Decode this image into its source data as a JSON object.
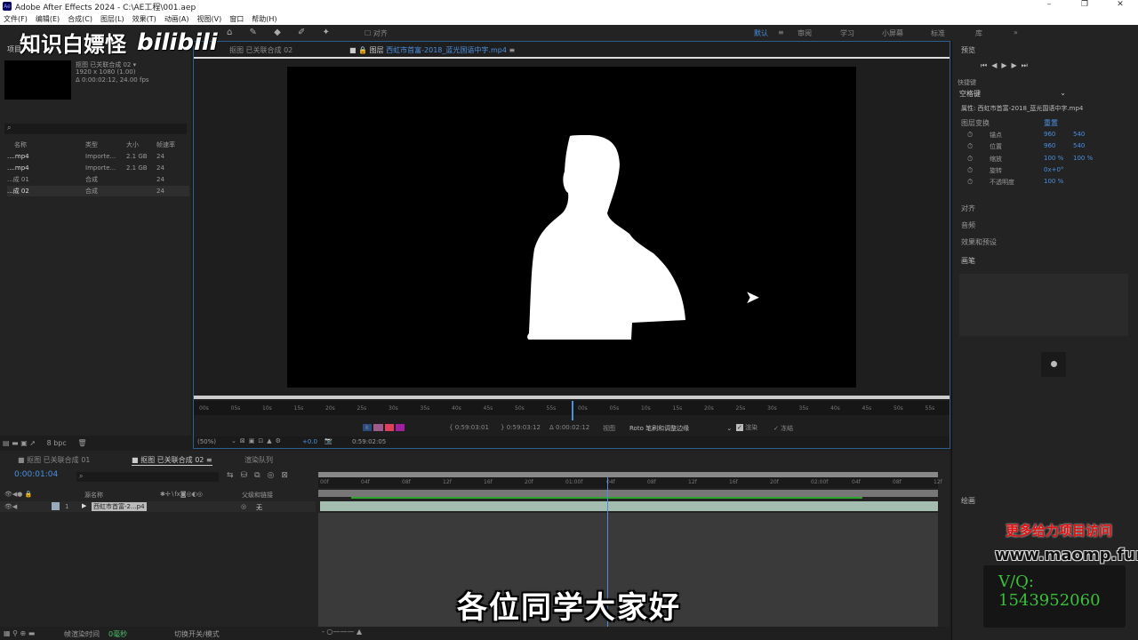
{
  "window": {
    "title": "Adobe After Effects 2024 - C:\\AE工程\\001.aep",
    "minimize": "–",
    "restore": "❐",
    "close": "✕"
  },
  "menu": [
    "文件(F)",
    "编辑(E)",
    "合成(C)",
    "图层(L)",
    "效果(T)",
    "动画(A)",
    "视图(V)",
    "窗口",
    "帮助(H)"
  ],
  "toolbar": {
    "align_label": "对齐",
    "workspaces": [
      "默认",
      "审阅",
      "学习",
      "小屏幕",
      "标准",
      "库",
      "»"
    ]
  },
  "watermark": {
    "channel": "知识白嫖怪",
    "site": "bilibili"
  },
  "project": {
    "tab": "项目",
    "comp_name": "抠图 已关联合成 02 ▾",
    "resolution": "1920 x 1080 (1.00)",
    "duration": "Δ 0:00:02:12, 24.00 fps",
    "search_placeholder": "",
    "columns": [
      "名称",
      "类型",
      "大小",
      "帧速率"
    ],
    "items": [
      {
        "name": "....mp4",
        "type": "Importe...",
        "size": "2.1 GB",
        "fps": "24"
      },
      {
        "name": "....mp4",
        "type": "Importe...",
        "size": "2.1 GB",
        "fps": "24"
      },
      {
        "name": "...成 01",
        "type": "合成",
        "size": "",
        "fps": "24"
      },
      {
        "name": "...成 02",
        "type": "合成",
        "size": "",
        "fps": "24"
      }
    ],
    "bpc": "8 bpc"
  },
  "viewer": {
    "tab_comp": "抠图 已关联合成 02",
    "tab_layer_prefix": "图层",
    "tab_layer_name": "西虹市首富-2018_蓝光国语中字.mp4",
    "ruler_ticks": [
      "00s",
      "05s",
      "10s",
      "15s",
      "20s",
      "25s",
      "30s",
      "35s",
      "40s",
      "45s",
      "50s",
      "55s",
      "00s",
      "05s",
      "10s",
      "15s",
      "20s",
      "25s",
      "30s",
      "35s",
      "40s",
      "45s",
      "50s",
      "55s"
    ],
    "in_point": "0:59:03:01",
    "out_point": "0:59:03:12",
    "duration": "Δ 0:00:02:12",
    "view_label": "视图",
    "view_value": "Roto 笔刷和调整边缘",
    "render_label": "渲染",
    "freeze_label": "冻结",
    "zoom": "(50%)",
    "exposure": "+0.0",
    "current_time": "0:59:02:05"
  },
  "timeline": {
    "tabs": [
      "抠图 已关联合成 01",
      "抠图 已关联合成 02",
      "渲染队列"
    ],
    "timecode": "0:00:01:04",
    "col_source": "源名称",
    "col_parent": "父级和链接",
    "layer": {
      "index": "1",
      "name": "西虹市首富-2...p4",
      "parent": "无"
    },
    "ticks": [
      "00f",
      "04f",
      "08f",
      "12f",
      "16f",
      "20f",
      "01:00f",
      "04f",
      "08f",
      "12f",
      "16f",
      "20f",
      "02:00f",
      "04f",
      "08f",
      "12f"
    ],
    "status_render": "帧渲染时间",
    "status_render_value": "0毫秒",
    "status_toggle": "切换开关/模式"
  },
  "right": {
    "preview": "预览",
    "shortcut_label": "快捷键",
    "shortcut_value": "空格键",
    "properties_title": "属性: 西虹市首富-2018_蓝光国语中字.mp4",
    "transform": "图层变换",
    "reset": "重置",
    "props": [
      {
        "name": "锚点",
        "v1": "960",
        "v2": "540"
      },
      {
        "name": "位置",
        "v1": "960",
        "v2": "540"
      },
      {
        "name": "缩放",
        "v1": "100 %",
        "v2": "100 %"
      },
      {
        "name": "旋转",
        "v1": "0x+0°",
        "v2": ""
      },
      {
        "name": "不透明度",
        "v1": "100 %",
        "v2": ""
      }
    ],
    "sections": [
      "对齐",
      "音频",
      "效果和预设"
    ],
    "brushes": "画笔",
    "paint": "绘画"
  },
  "promo": {
    "line1": "更多给力项目访问",
    "url": "www.maomp.fun",
    "contact": "V/Q: 1543952060"
  },
  "subtitle": "各位同学大家好"
}
